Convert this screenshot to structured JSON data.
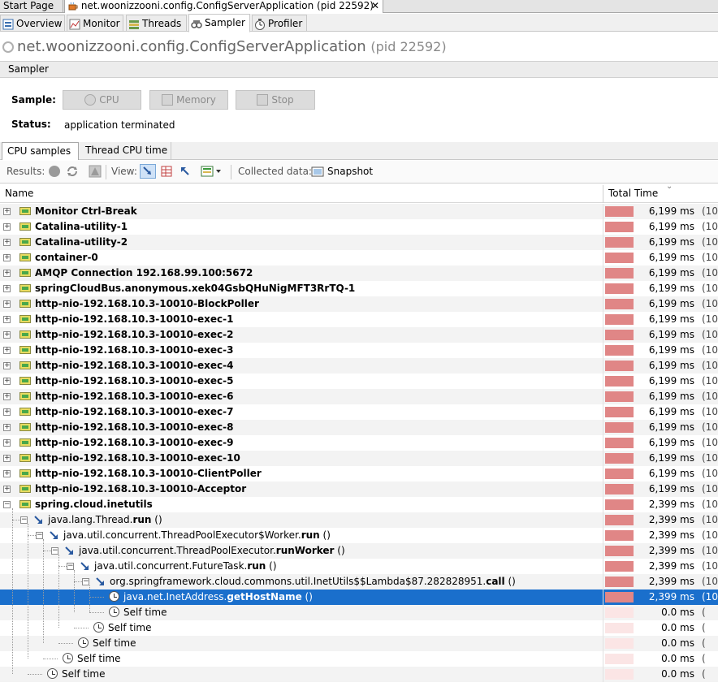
{
  "window_tabs": [
    {
      "label": "Start Page"
    },
    {
      "label": "net.woonizzooni.config.ConfigServerApplication (pid 22592)",
      "close": "✕"
    }
  ],
  "view_tabs": [
    {
      "label": "Overview",
      "icon": "overview-icon"
    },
    {
      "label": "Monitor",
      "icon": "monitor-icon"
    },
    {
      "label": "Threads",
      "icon": "threads-icon"
    },
    {
      "label": "Sampler",
      "icon": "sampler-icon",
      "selected": true
    },
    {
      "label": "Profiler",
      "icon": "profiler-icon"
    }
  ],
  "app": {
    "name": "net.woonizzooni.config.ConfigServerApplication",
    "pid": "(pid 22592)"
  },
  "section": "Sampler",
  "sample": {
    "label": "Sample:",
    "cpu": "CPU",
    "memory": "Memory",
    "stop": "Stop"
  },
  "status": {
    "label": "Status:",
    "value": "application terminated"
  },
  "sub_tabs": [
    "CPU samples",
    "Thread CPU time"
  ],
  "toolbar": {
    "results": "Results:",
    "view": "View:",
    "collected": "Collected data:",
    "snapshot": "Snapshot"
  },
  "table": {
    "col_name": "Name",
    "col_total": "Total Time"
  },
  "colors": {
    "bar": "#e08686",
    "bar_empty": "#fbe5e5",
    "selection": "#1a6fcc"
  },
  "rows": [
    {
      "kind": "thread",
      "name": "Monitor Ctrl-Break",
      "time": "6,199 ms",
      "pct": "(10",
      "bar": 1.0
    },
    {
      "kind": "thread",
      "name": "Catalina-utility-1",
      "time": "6,199 ms",
      "pct": "(10",
      "bar": 1.0
    },
    {
      "kind": "thread",
      "name": "Catalina-utility-2",
      "time": "6,199 ms",
      "pct": "(10",
      "bar": 1.0
    },
    {
      "kind": "thread",
      "name": "container-0",
      "time": "6,199 ms",
      "pct": "(10",
      "bar": 1.0
    },
    {
      "kind": "thread",
      "name": "AMQP Connection 192.168.99.100:5672",
      "time": "6,199 ms",
      "pct": "(10",
      "bar": 1.0
    },
    {
      "kind": "thread",
      "name": "springCloudBus.anonymous.xek04GsbQHuNigMFT3RrTQ-1",
      "time": "6,199 ms",
      "pct": "(10",
      "bar": 1.0
    },
    {
      "kind": "thread",
      "name": "http-nio-192.168.10.3-10010-BlockPoller",
      "time": "6,199 ms",
      "pct": "(10",
      "bar": 1.0
    },
    {
      "kind": "thread",
      "name": "http-nio-192.168.10.3-10010-exec-1",
      "time": "6,199 ms",
      "pct": "(10",
      "bar": 1.0
    },
    {
      "kind": "thread",
      "name": "http-nio-192.168.10.3-10010-exec-2",
      "time": "6,199 ms",
      "pct": "(10",
      "bar": 1.0
    },
    {
      "kind": "thread",
      "name": "http-nio-192.168.10.3-10010-exec-3",
      "time": "6,199 ms",
      "pct": "(10",
      "bar": 1.0
    },
    {
      "kind": "thread",
      "name": "http-nio-192.168.10.3-10010-exec-4",
      "time": "6,199 ms",
      "pct": "(10",
      "bar": 1.0
    },
    {
      "kind": "thread",
      "name": "http-nio-192.168.10.3-10010-exec-5",
      "time": "6,199 ms",
      "pct": "(10",
      "bar": 1.0
    },
    {
      "kind": "thread",
      "name": "http-nio-192.168.10.3-10010-exec-6",
      "time": "6,199 ms",
      "pct": "(10",
      "bar": 1.0
    },
    {
      "kind": "thread",
      "name": "http-nio-192.168.10.3-10010-exec-7",
      "time": "6,199 ms",
      "pct": "(10",
      "bar": 1.0
    },
    {
      "kind": "thread",
      "name": "http-nio-192.168.10.3-10010-exec-8",
      "time": "6,199 ms",
      "pct": "(10",
      "bar": 1.0
    },
    {
      "kind": "thread",
      "name": "http-nio-192.168.10.3-10010-exec-9",
      "time": "6,199 ms",
      "pct": "(10",
      "bar": 1.0
    },
    {
      "kind": "thread",
      "name": "http-nio-192.168.10.3-10010-exec-10",
      "time": "6,199 ms",
      "pct": "(10",
      "bar": 1.0
    },
    {
      "kind": "thread",
      "name": "http-nio-192.168.10.3-10010-ClientPoller",
      "time": "6,199 ms",
      "pct": "(10",
      "bar": 1.0
    },
    {
      "kind": "thread",
      "name": "http-nio-192.168.10.3-10010-Acceptor",
      "time": "6,199 ms",
      "pct": "(10",
      "bar": 1.0
    },
    {
      "kind": "thread",
      "name": "spring.cloud.inetutils",
      "time": "2,399 ms",
      "pct": "(10",
      "bar": 1.0,
      "expanded": true
    },
    {
      "kind": "method",
      "depth": 1,
      "name": "java.lang.Thread.",
      "method": "run",
      "suffix": " ()",
      "time": "2,399 ms",
      "pct": "(10",
      "bar": 1.0
    },
    {
      "kind": "method",
      "depth": 2,
      "name": "java.util.concurrent.ThreadPoolExecutor$Worker.",
      "method": "run",
      "suffix": " ()",
      "time": "2,399 ms",
      "pct": "(10",
      "bar": 1.0
    },
    {
      "kind": "method",
      "depth": 3,
      "name": "java.util.concurrent.ThreadPoolExecutor.",
      "method": "runWorker",
      "suffix": " ()",
      "time": "2,399 ms",
      "pct": "(10",
      "bar": 1.0
    },
    {
      "kind": "method",
      "depth": 4,
      "name": "java.util.concurrent.FutureTask.",
      "method": "run",
      "suffix": " ()",
      "time": "2,399 ms",
      "pct": "(10",
      "bar": 1.0
    },
    {
      "kind": "method",
      "depth": 5,
      "name": "org.springframework.cloud.commons.util.InetUtils$$Lambda$87.282828951.",
      "method": "call",
      "suffix": " ()",
      "time": "2,399 ms",
      "pct": "(10",
      "bar": 1.0
    },
    {
      "kind": "leaf",
      "depth": 6,
      "name": "java.net.InetAddress.",
      "method": "getHostName",
      "suffix": " ()",
      "time": "2,399 ms",
      "pct": "(10",
      "bar": 1.0,
      "selected": true
    },
    {
      "kind": "self",
      "depth": 6,
      "name": "Self time",
      "time": "0.0 ms",
      "pct": "(",
      "bar": 0.0
    },
    {
      "kind": "self",
      "depth": 5,
      "name": "Self time",
      "time": "0.0 ms",
      "pct": "(",
      "bar": 0.0
    },
    {
      "kind": "self",
      "depth": 4,
      "name": "Self time",
      "time": "0.0 ms",
      "pct": "(",
      "bar": 0.0
    },
    {
      "kind": "self",
      "depth": 3,
      "name": "Self time",
      "time": "0.0 ms",
      "pct": "(",
      "bar": 0.0
    },
    {
      "kind": "self",
      "depth": 2,
      "name": "Self time",
      "time": "0.0 ms",
      "pct": "(",
      "bar": 0.0
    }
  ]
}
